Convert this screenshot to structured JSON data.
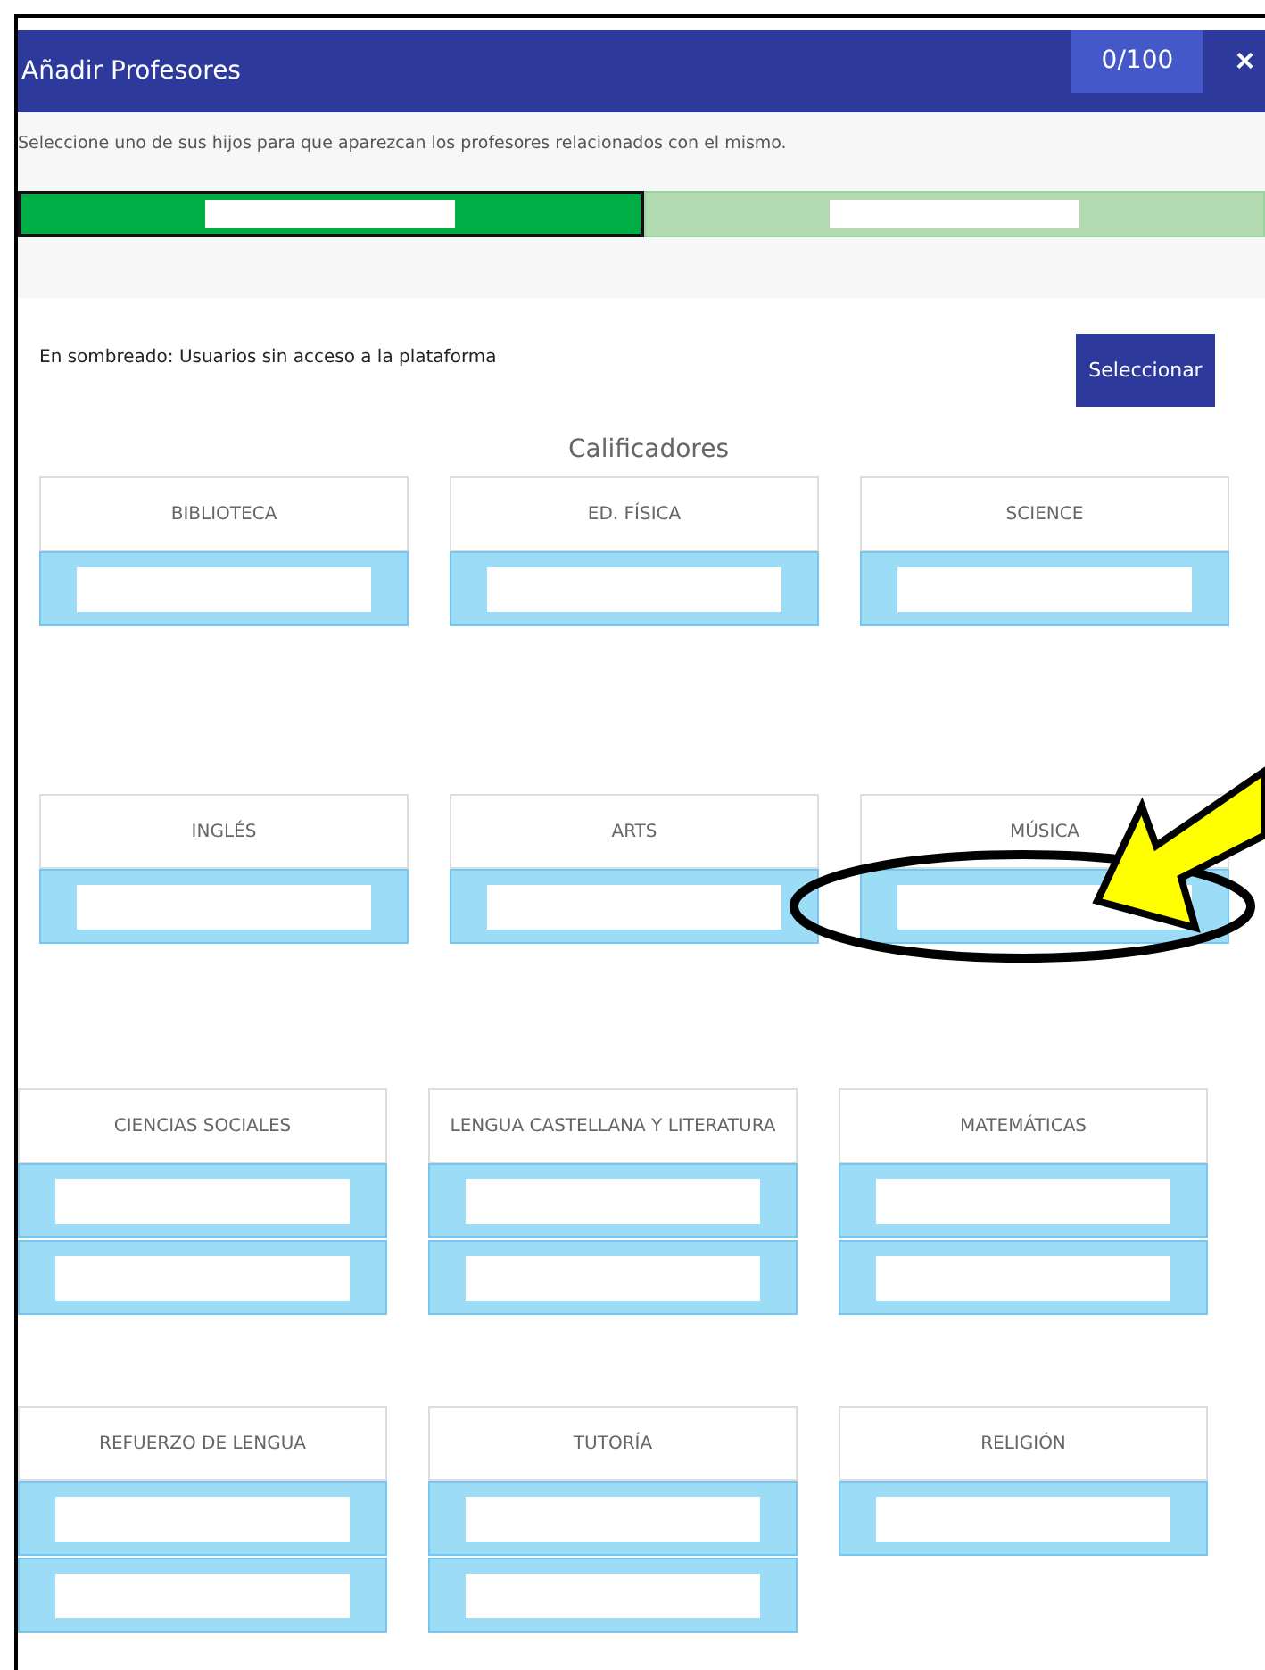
{
  "window": {
    "title": "Añadir Profesores",
    "counter": "0/100",
    "close": "×"
  },
  "instruction": "Seleccione uno de sus hijos para que aparezcan los profesores relacionados con el mismo.",
  "tabs": [
    {
      "kind": "redacted",
      "selected": true
    },
    {
      "kind": "redacted",
      "selected": false
    }
  ],
  "legend": "En sombreado: Usuarios sin acceso a la plataforma",
  "select_button": "Seleccionar",
  "section_title": "Calificadores",
  "rows": [
    {
      "subjects": [
        {
          "name": "BIBLIOTECA",
          "teachers": [
            {
              "kind": "redacted"
            }
          ]
        },
        {
          "name": "ED. FÍSICA",
          "teachers": [
            {
              "kind": "redacted"
            }
          ]
        },
        {
          "name": "SCIENCE",
          "teachers": [
            {
              "kind": "redacted"
            }
          ]
        }
      ]
    },
    {
      "subjects": [
        {
          "name": "INGLÉS",
          "teachers": [
            {
              "kind": "redacted"
            }
          ]
        },
        {
          "name": "ARTS",
          "teachers": [
            {
              "kind": "redacted"
            }
          ]
        },
        {
          "name": "MÚSICA",
          "teachers": [
            {
              "kind": "redacted"
            }
          ]
        }
      ]
    },
    {
      "subjects": [
        {
          "name": "CIENCIAS SOCIALES",
          "teachers": [
            {
              "kind": "redacted"
            },
            {
              "kind": "redacted"
            }
          ]
        },
        {
          "name": "LENGUA CASTELLANA Y LITERATURA",
          "teachers": [
            {
              "kind": "redacted"
            },
            {
              "kind": "redacted"
            }
          ]
        },
        {
          "name": "MATEMÁTICAS",
          "teachers": [
            {
              "kind": "redacted"
            },
            {
              "kind": "redacted"
            }
          ]
        }
      ]
    },
    {
      "subjects": [
        {
          "name": "REFUERZO DE LENGUA",
          "teachers": [
            {
              "kind": "redacted"
            },
            {
              "kind": "redacted"
            }
          ]
        },
        {
          "name": "TUTORÍA",
          "teachers": [
            {
              "kind": "redacted"
            },
            {
              "kind": "redacted"
            }
          ]
        },
        {
          "name": "RELIGIÓN",
          "teachers": [
            {
              "kind": "redacted"
            }
          ]
        }
      ]
    }
  ],
  "annotation": {
    "kind": "arrow-ellipse"
  }
}
